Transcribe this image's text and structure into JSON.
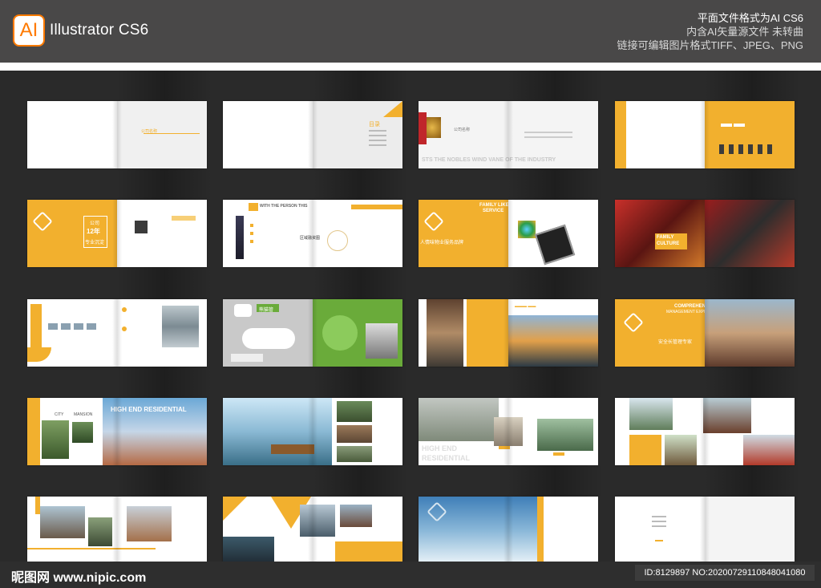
{
  "header": {
    "logo_text": "AI",
    "app_name": "Illustrator CS6",
    "format_lines": [
      "平面文件格式为AI CS6",
      "内含AI矢量源文件  未转曲",
      "链接可编辑图片格式TIFF、JPEG、PNG"
    ]
  },
  "spreads": {
    "r1c1": {
      "text": "公司名称"
    },
    "r1c2": {
      "text": "目录"
    },
    "r1c3": {
      "name": "公司名称",
      "banner": "STS THE NOBLES WIND VANE OF THE INDUSTRY"
    },
    "r2c1": {
      "lines": [
        "公司",
        "12年",
        "专业沉淀"
      ]
    },
    "r2c2": {
      "banner": "WITH THE PERSON THIS",
      "label": "区域融资图"
    },
    "r2c3": {
      "banner": [
        "FAMILY LIKE",
        "SERVICE"
      ],
      "label": "人情味物业服务品牌"
    },
    "r2c4": {
      "banner": [
        "FAMILY",
        "CULTURE"
      ]
    },
    "r3c2": {
      "label": "熊猫管"
    },
    "r4c1": {
      "city": "CITY",
      "mansion": "MANSION",
      "banner": "HIGH END RESIDENTIAL"
    },
    "r4c3": {
      "banner": [
        "HIGH END",
        "RESIDENTIAL"
      ]
    },
    "r3c4": {
      "banner": [
        "COMPREHENSIVE",
        "MANAGEMENT EXPERT"
      ],
      "label": "安全长管理专家"
    }
  },
  "footer": {
    "watermark": "昵图网 www.nipic.com",
    "id_text": "ID:8129897 NO:20200729110848041080"
  },
  "colors": {
    "accent": "#f2b02e",
    "bar": "#494848",
    "background": "#2a2a2a"
  }
}
